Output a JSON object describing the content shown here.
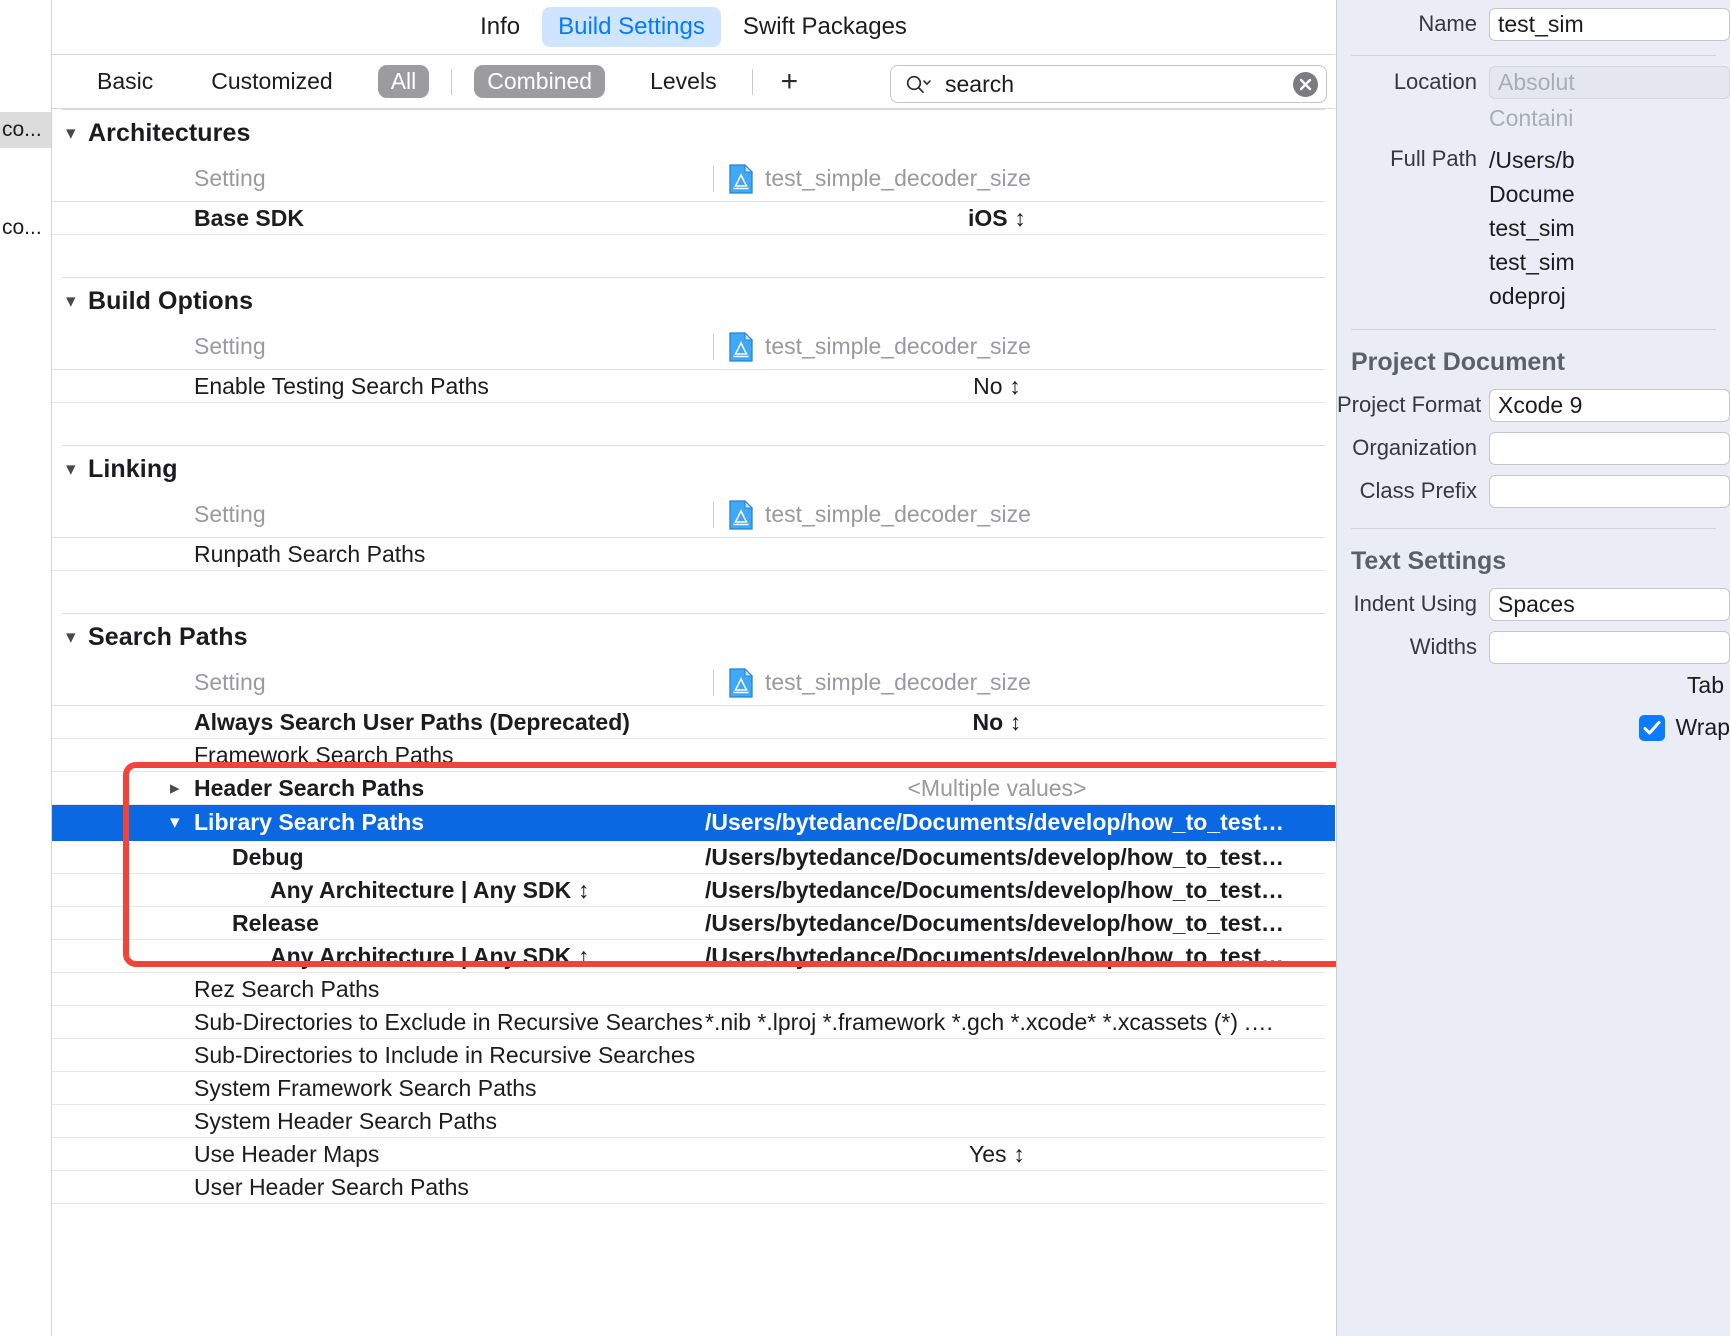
{
  "left_sidebar": {
    "items": [
      {
        "label": "co...",
        "selected": true
      },
      {
        "label": "co...",
        "selected": false
      }
    ]
  },
  "tabs": [
    {
      "label": "Info",
      "active": false
    },
    {
      "label": "Build Settings",
      "active": true
    },
    {
      "label": "Swift Packages",
      "active": false
    }
  ],
  "filter_bar": {
    "basic": "Basic",
    "customized": "Customized",
    "all": "All",
    "combined": "Combined",
    "levels": "Levels",
    "plus": "+"
  },
  "search": {
    "value": "search",
    "placeholder": "search",
    "icon": "search-icon",
    "clear_icon": "clear-icon"
  },
  "target": {
    "name": "test_simple_decoder_size",
    "icon": "app-target-icon"
  },
  "column_header": {
    "setting": "Setting"
  },
  "groups": [
    {
      "title": "Architectures",
      "rows": [
        {
          "name": "Base SDK",
          "value": "iOS",
          "bold": true,
          "indent": 0,
          "stepper": true
        }
      ]
    },
    {
      "title": "Build Options",
      "rows": [
        {
          "name": "Enable Testing Search Paths",
          "value": "No",
          "bold": false,
          "indent": 0,
          "stepper": true
        }
      ]
    },
    {
      "title": "Linking",
      "rows": [
        {
          "name": "Runpath Search Paths",
          "value": "",
          "bold": false,
          "indent": 0,
          "stepper": false
        }
      ]
    },
    {
      "title": "Search Paths",
      "rows": [
        {
          "name": "Always Search User Paths (Deprecated)",
          "value": "No",
          "bold": true,
          "indent": 0,
          "stepper": true
        },
        {
          "name": "Framework Search Paths",
          "value": "",
          "bold": false,
          "indent": 0,
          "stepper": false
        },
        {
          "name": "Header Search Paths",
          "value": "<Multiple values>",
          "bold": true,
          "indent": 0,
          "stepper": false,
          "disclosure": "collapsed",
          "value_placeholder": true
        },
        {
          "name": "Library Search Paths",
          "value": "/Users/bytedance/Documents/develop/how_to_test_p...",
          "bold": true,
          "indent": 0,
          "stepper": false,
          "disclosure": "expanded",
          "selected": true
        },
        {
          "name": "Debug",
          "value": "/Users/bytedance/Documents/develop/how_to_test_p...",
          "bold": true,
          "indent": 1,
          "stepper": false
        },
        {
          "name": "Any Architecture | Any SDK",
          "value": "/Users/bytedance/Documents/develop/how_to_test_p...",
          "bold": true,
          "indent": 2,
          "stepper": true
        },
        {
          "name": "Release",
          "value": "/Users/bytedance/Documents/develop/how_to_test_p...",
          "bold": true,
          "indent": 1,
          "stepper": false
        },
        {
          "name": "Any Architecture | Any SDK",
          "value": "/Users/bytedance/Documents/develop/how_to_test_p...",
          "bold": true,
          "indent": 2,
          "stepper": true
        },
        {
          "name": "Rez Search Paths",
          "value": "",
          "bold": false,
          "indent": 0,
          "stepper": false
        },
        {
          "name": "Sub-Directories to Exclude in Recursive Searches",
          "value": "*.nib *.lproj *.framework *.gch *.xcode* *.xcassets (*) .DS_S...",
          "bold": false,
          "indent": 0,
          "stepper": false
        },
        {
          "name": "Sub-Directories to Include in Recursive Searches",
          "value": "",
          "bold": false,
          "indent": 0,
          "stepper": false
        },
        {
          "name": "System Framework Search Paths",
          "value": "",
          "bold": false,
          "indent": 0,
          "stepper": false
        },
        {
          "name": "System Header Search Paths",
          "value": "",
          "bold": false,
          "indent": 0,
          "stepper": false
        },
        {
          "name": "Use Header Maps",
          "value": "Yes",
          "bold": false,
          "indent": 0,
          "stepper": true
        },
        {
          "name": "User Header Search Paths",
          "value": "",
          "bold": false,
          "indent": 0,
          "stepper": false
        }
      ]
    }
  ],
  "inspector": {
    "identity": {
      "name_label": "Name",
      "name_value": "test_sim",
      "location_label": "Location",
      "location_value": "Absolut",
      "containing_text": "Containi",
      "full_path_label": "Full Path",
      "full_path_lines": [
        "/Users/b",
        "Docume",
        "test_sim",
        "test_sim",
        "odeproj"
      ]
    },
    "project_document": {
      "title": "Project Document",
      "project_format_label": "Project Format",
      "project_format_value": "Xcode 9",
      "organization_label": "Organization",
      "organization_value": "",
      "class_prefix_label": "Class Prefix",
      "class_prefix_value": ""
    },
    "text_settings": {
      "title": "Text Settings",
      "indent_using_label": "Indent Using",
      "indent_using_value": "Spaces",
      "widths_label": "Widths",
      "widths_value": "",
      "tab_label": "Tab",
      "wrap_label": "Wrap",
      "wrap_checked": true
    }
  },
  "colors": {
    "selection_blue": "#0b68e3",
    "accent_blue": "#067aff",
    "annotation_red": "#f04438",
    "pill_gray": "#9c9c9f",
    "inspector_bg": "#eaedf5"
  }
}
